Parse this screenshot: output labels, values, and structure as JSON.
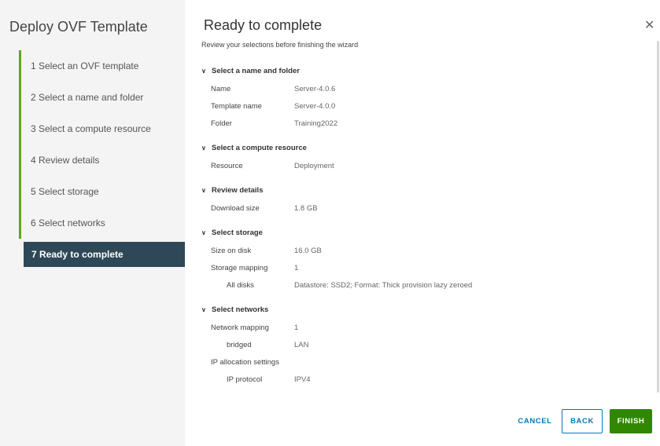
{
  "sidebar": {
    "title": "Deploy OVF Template",
    "steps": [
      {
        "label": "1  Select an OVF template"
      },
      {
        "label": "2  Select a name and folder"
      },
      {
        "label": "3  Select a compute resource"
      },
      {
        "label": "4  Review details"
      },
      {
        "label": "5  Select storage"
      },
      {
        "label": "6  Select networks"
      },
      {
        "label": "7  Ready to complete"
      }
    ]
  },
  "main": {
    "title": "Ready to complete",
    "subtitle": "Review your selections before finishing the wizard",
    "sections": {
      "name_folder": {
        "heading": "Select a name and folder",
        "rows": [
          {
            "label": "Name",
            "value": "Server-4.0.6"
          },
          {
            "label": "Template name",
            "value": "Server-4.0.0"
          },
          {
            "label": "Folder",
            "value": "Training2022"
          }
        ]
      },
      "compute": {
        "heading": "Select a compute resource",
        "rows": [
          {
            "label": "Resource",
            "value": "Deployment"
          }
        ]
      },
      "review": {
        "heading": "Review details",
        "rows": [
          {
            "label": "Download size",
            "value": "1.8 GB"
          }
        ]
      },
      "storage": {
        "heading": "Select storage",
        "rows": [
          {
            "label": "Size on disk",
            "value": "16.0 GB"
          },
          {
            "label": "Storage mapping",
            "value": "1"
          },
          {
            "label": "All disks",
            "value": "Datastore: SSD2; Format: Thick provision lazy zeroed"
          }
        ]
      },
      "networks": {
        "heading": "Select networks",
        "rows": [
          {
            "label": "Network mapping",
            "value": "1"
          },
          {
            "label": "bridged",
            "value": "LAN"
          },
          {
            "label": "IP allocation settings",
            "value": ""
          },
          {
            "label": "IP protocol",
            "value": "IPV4"
          }
        ]
      }
    }
  },
  "footer": {
    "cancel": "CANCEL",
    "back": "BACK",
    "finish": "FINISH"
  },
  "icons": {
    "close": "close-icon",
    "chevron": "chevron-down-icon"
  },
  "colors": {
    "active_step": "#2f4858",
    "completed_bar": "#62a420",
    "primary_link": "#0079b8",
    "finish_button": "#318700"
  }
}
